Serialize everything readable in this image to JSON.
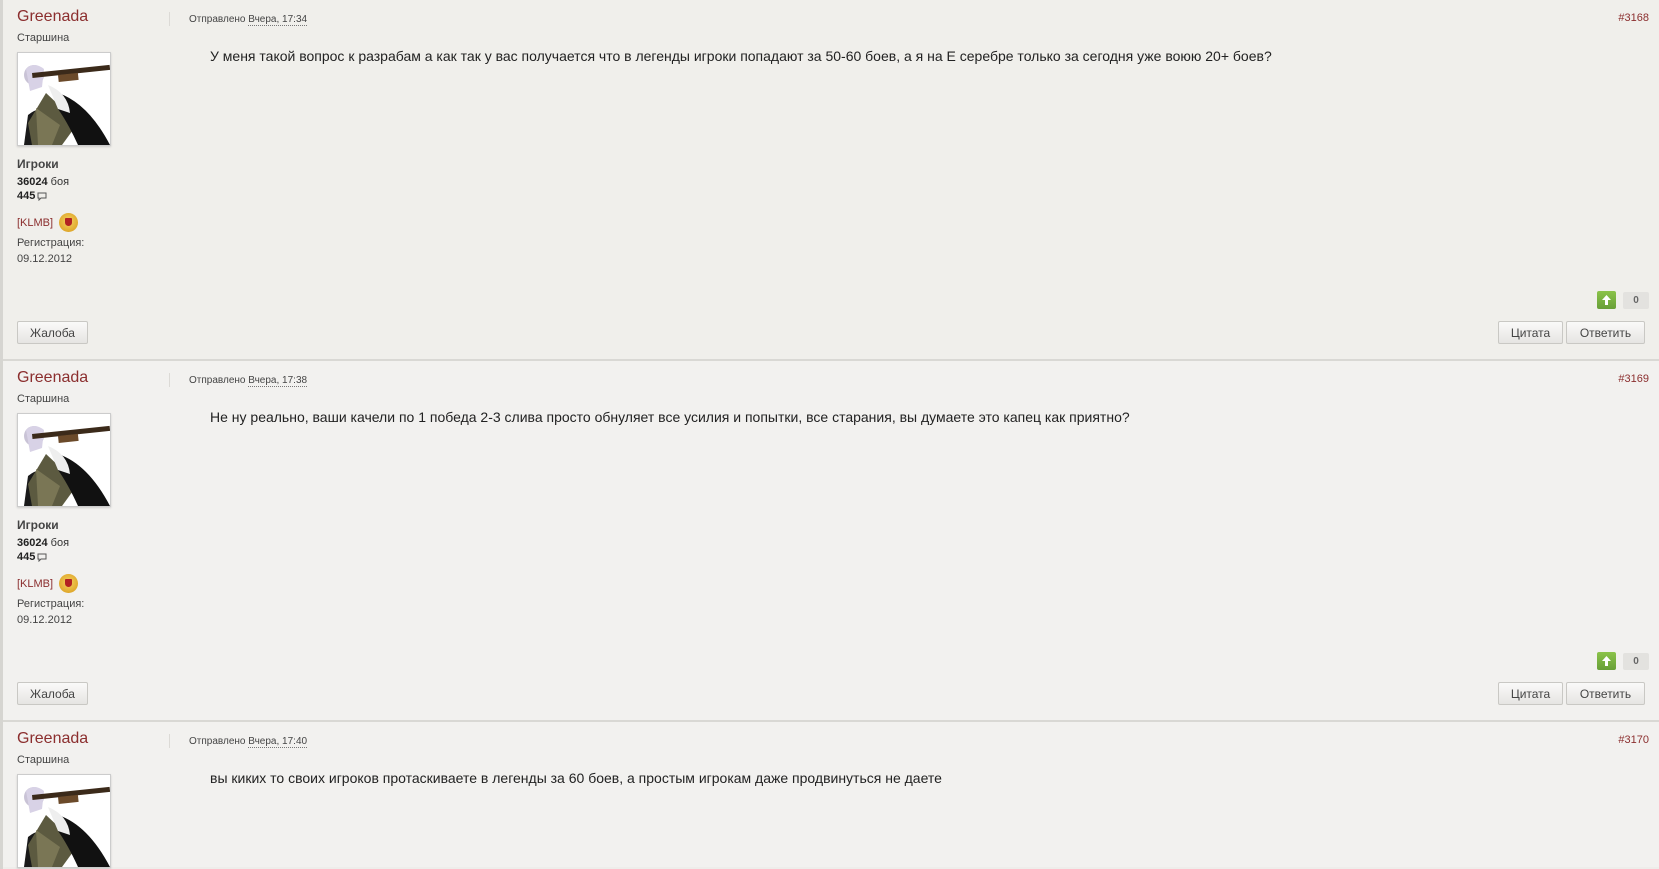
{
  "posts": [
    {
      "author": "Greenada",
      "rank": "Старшина",
      "group": "Игроки",
      "battles_count": "36024",
      "battles_label": "боя",
      "comments_count": "445",
      "clan_tag": "[KLMB]",
      "reg_label": "Регистрация:",
      "reg_date": "09.12.2012",
      "posted_label": "Отправлено",
      "posted_time": "Вчера, 17:34",
      "post_number": "#3168",
      "text": "У меня такой вопрос к разрабам а как так у вас получается что в легенды игроки попадают за 50-60 боев, а я на Е серебре только за сегодня уже воюю 20+ боев?",
      "votes": "0",
      "report_label": "Жалоба",
      "quote_label": "Цитата",
      "reply_label": "Ответить"
    },
    {
      "author": "Greenada",
      "rank": "Старшина",
      "group": "Игроки",
      "battles_count": "36024",
      "battles_label": "боя",
      "comments_count": "445",
      "clan_tag": "[KLMB]",
      "reg_label": "Регистрация:",
      "reg_date": "09.12.2012",
      "posted_label": "Отправлено",
      "posted_time": "Вчера, 17:38",
      "post_number": "#3169",
      "text": "Не ну реально, ваши качели по 1 победа 2-3 слива просто обнуляет все усилия и попытки, все старания, вы думаете это капец как приятно?",
      "votes": "0",
      "report_label": "Жалоба",
      "quote_label": "Цитата",
      "reply_label": "Ответить"
    },
    {
      "author": "Greenada",
      "rank": "Старшина",
      "posted_label": "Отправлено",
      "posted_time": "Вчера, 17:40",
      "post_number": "#3170",
      "text": "вы киких то своих игроков протаскиваете в легенды за 60 боев, а простым игрокам даже продвинуться не даете"
    }
  ],
  "colors": {
    "accent": "#8b2e2e",
    "vote_up": "#7cb342"
  }
}
